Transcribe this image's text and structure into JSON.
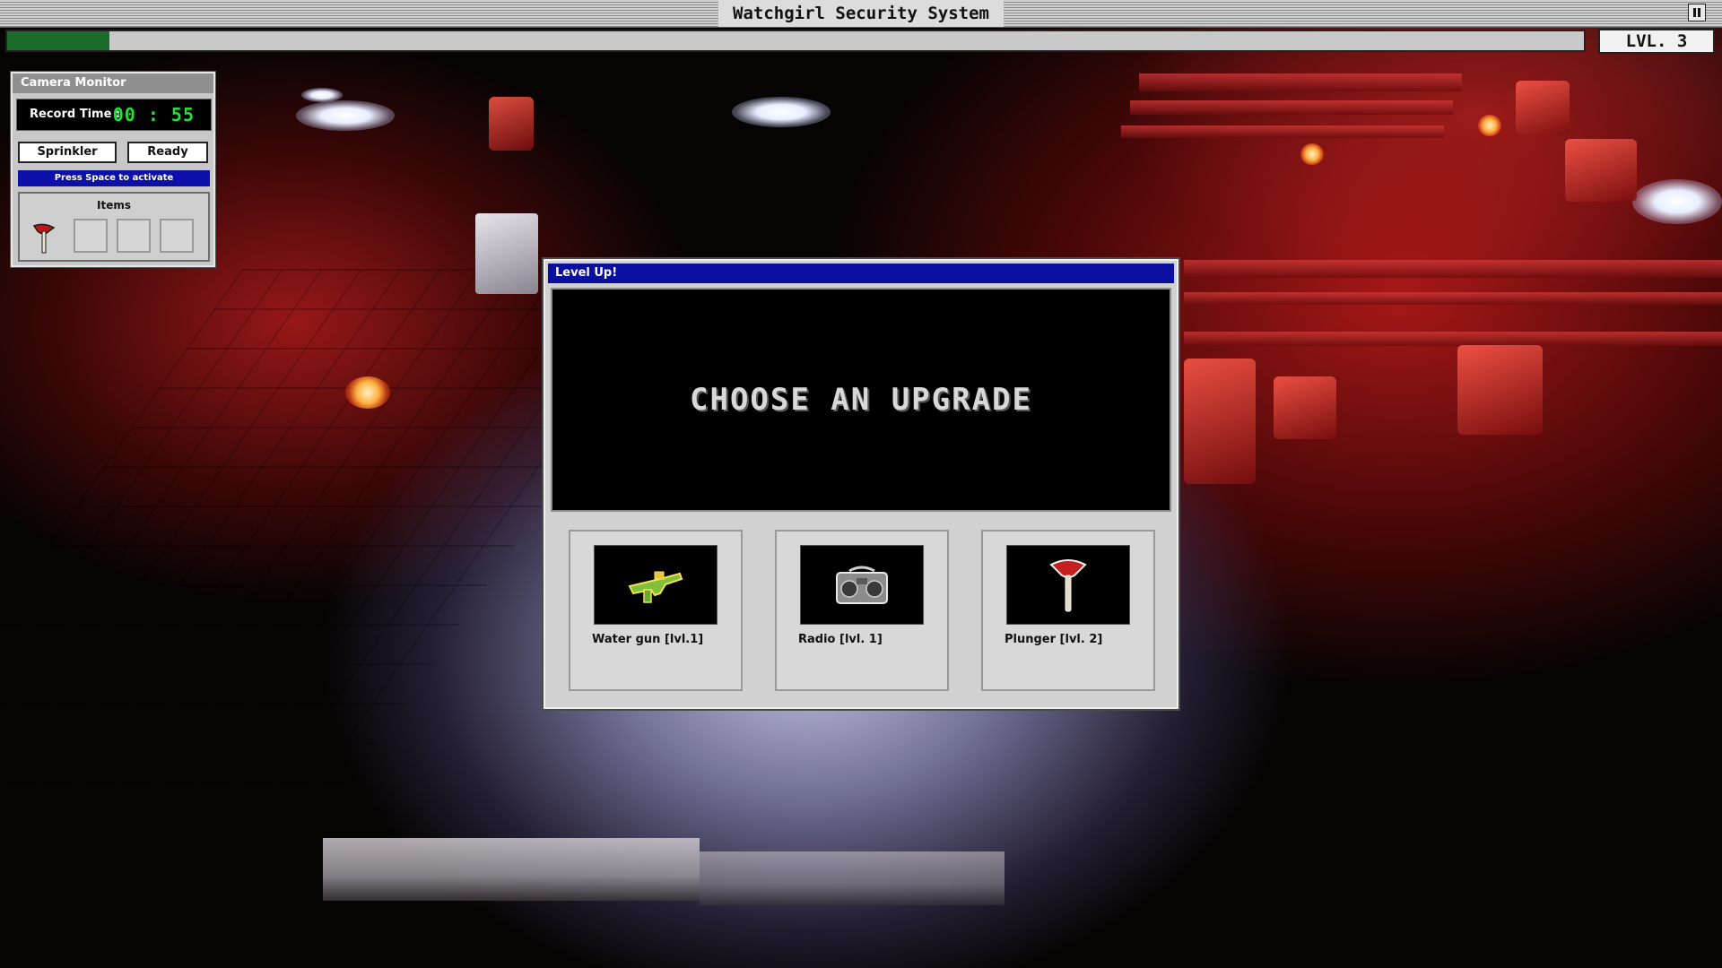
{
  "window": {
    "title": "Watchgirl Security System",
    "pause_icon": "pause-icon"
  },
  "progress": {
    "xp_fraction": 0.065,
    "level_label": "LVL. 3",
    "bar_color": "#1b6b2a"
  },
  "camera_monitor": {
    "title": "Camera Monitor",
    "record_label": "Record Time :",
    "record_time": "00 : 55",
    "record_color": "#22e035",
    "sprinkler_label": "Sprinkler",
    "status_label": "Ready",
    "hint": "Press Space to activate",
    "items_title": "Items",
    "items": [
      {
        "icon": "plunger-icon"
      },
      {
        "icon": ""
      },
      {
        "icon": ""
      },
      {
        "icon": ""
      }
    ]
  },
  "level_up": {
    "title": "Level Up!",
    "headline": "CHOOSE AN UPGRADE",
    "title_bar_color": "#0b0fa0",
    "options": [
      {
        "label": "Water gun [lvl.1]",
        "icon": "water-gun-icon"
      },
      {
        "label": "Radio [lvl. 1]",
        "icon": "radio-icon"
      },
      {
        "label": "Plunger [lvl. 2]",
        "icon": "plunger-icon"
      }
    ]
  }
}
